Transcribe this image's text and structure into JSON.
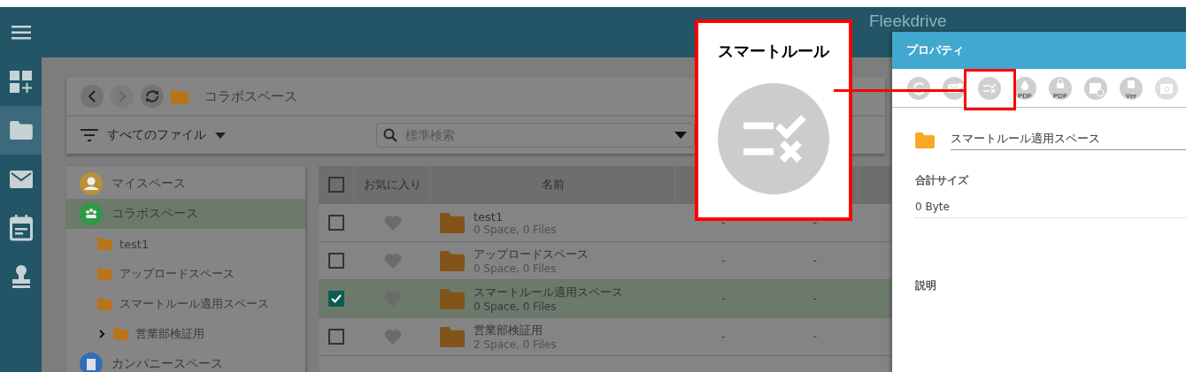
{
  "header": {
    "logo_text": "Fleekdrive"
  },
  "rail": [
    {
      "kind": "menu",
      "selected": false
    },
    {
      "kind": "dashboard",
      "selected": false
    },
    {
      "kind": "folder",
      "selected": true
    },
    {
      "kind": "mail",
      "selected": false
    },
    {
      "kind": "calendar",
      "selected": false
    },
    {
      "kind": "stamp",
      "selected": false
    }
  ],
  "breadcrumb": {
    "current": "コラボスペース"
  },
  "filter": {
    "label": "すべてのファイル"
  },
  "search": {
    "placeholder": "標準検索"
  },
  "tree": [
    {
      "label": "マイスペース",
      "kind": "person",
      "color": "#b8913a",
      "selected": false
    },
    {
      "label": "コラボスペース",
      "kind": "group",
      "color": "#2e9a48",
      "selected": true,
      "children": [
        {
          "label": "test1",
          "selected": false
        },
        {
          "label": "アップロードスペース",
          "selected": false
        },
        {
          "label": "スマートルール適用スペース",
          "selected": false
        },
        {
          "label": "営業部検証用",
          "selected": false,
          "expanded": false
        }
      ]
    },
    {
      "label": "カンパニースペース",
      "kind": "company",
      "color": "#2f6fb5",
      "selected": false
    }
  ],
  "table": {
    "select_all_checked": false,
    "columns": [
      "お気に入り",
      "名前"
    ],
    "rows": [
      {
        "name": "test1",
        "meta": "0 Space, 0 Files",
        "checked": false,
        "column_4": "-",
        "column_5": "-"
      },
      {
        "name": "アップロードスペース",
        "meta": "0 Space, 0 Files",
        "checked": false,
        "column_4": "-",
        "column_5": "-"
      },
      {
        "name": "スマートルール適用スペース",
        "meta": "0 Space, 0 Files",
        "checked": true,
        "column_4": "-",
        "column_5": "-"
      },
      {
        "name": "営業部検証用",
        "meta": "2 Space, 0 Files",
        "checked": false,
        "column_4": "-",
        "column_5": "-"
      }
    ]
  },
  "properties": {
    "title": "プロパティ",
    "tools": [
      {
        "kind": "sync",
        "highlighted": false
      },
      {
        "kind": "mail",
        "highlighted": false
      },
      {
        "kind": "rule",
        "highlighted": true
      },
      {
        "kind": "pdf-drop",
        "badge": "PDF",
        "highlighted": false
      },
      {
        "kind": "pdf-lock",
        "badge": "PDF",
        "highlighted": false
      },
      {
        "kind": "schedule",
        "highlighted": false
      },
      {
        "kind": "version",
        "badge": "Ver",
        "highlighted": false
      },
      {
        "kind": "folder-block",
        "highlighted": false
      }
    ],
    "name": "スマートルール適用スペース",
    "size_label": "合計サイズ",
    "size": "0 Byte",
    "description_label": "説明"
  },
  "callout": {
    "title": "スマートルール"
  }
}
